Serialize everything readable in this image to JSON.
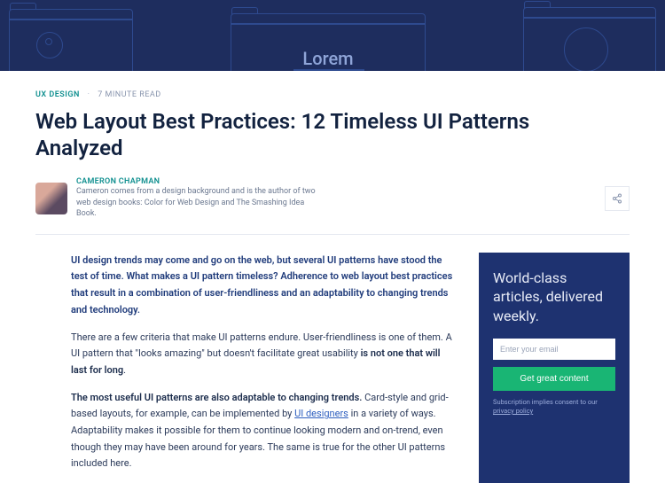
{
  "hero": {
    "wireframe_text": "Lorem"
  },
  "meta": {
    "category": "UX DESIGN",
    "read_time": "7 MINUTE READ"
  },
  "title": "Web Layout Best Practices: 12 Timeless UI Patterns Analyzed",
  "author": {
    "name": "CAMERON CHAPMAN",
    "bio": "Cameron comes from a design background and is the author of two web design books: Color for Web Design and The Smashing Idea Book."
  },
  "article": {
    "p1": "UI design trends may come and go on the web, but several UI patterns have stood the test of time. What makes a UI pattern timeless? Adherence to web layout best practices that result in a combination of user-friendliness and an adaptability to changing trends and technology.",
    "p2a": "There are a few criteria that make UI patterns endure. User-friendliness is one of them. A UI pattern that \"looks amazing\" but doesn't facilitate great usability ",
    "p2b": "is not one that will last for long",
    "p2c": ".",
    "p3a": "The most useful UI patterns are also adaptable to changing trends.",
    "p3b": " Card-style and grid-based layouts, for example, can be implemented by ",
    "p3c": "UI designers",
    "p3d": " in a variety of ways. Adaptability makes it possible for them to continue looking modern and on-trend, even though they may have been around for years. The same is true for the other UI patterns included here."
  },
  "sidebar": {
    "heading": "World-class articles, delivered weekly.",
    "placeholder": "Enter your email",
    "cta": "Get great content",
    "disclaimer_a": "Subscription implies consent to our ",
    "disclaimer_b": "privacy policy"
  }
}
